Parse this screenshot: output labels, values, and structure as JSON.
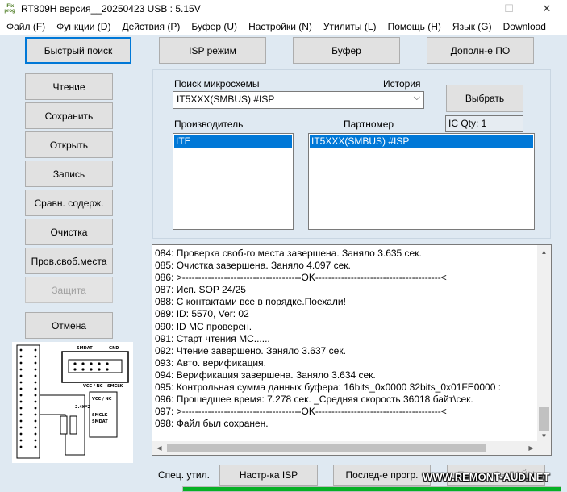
{
  "window": {
    "title": "RT809H версия__20250423  USB : 5.15V",
    "icon_text": [
      "iFix",
      "prog"
    ],
    "controls": {
      "minimize": "—",
      "maximize": "☐",
      "close": "✕"
    }
  },
  "menu": [
    "Файл (F)",
    "Функции (D)",
    "Действия (P)",
    "Буфер (U)",
    "Настройки (N)",
    "Утилиты (L)",
    "Помощь (H)",
    "Язык (G)",
    "Download"
  ],
  "top_buttons": {
    "quick_search": "Быстрый поиск",
    "isp_mode": "ISP режим",
    "buffer": "Буфер",
    "extra_software": "Дополн-е ПО"
  },
  "left_buttons": {
    "read": "Чтение",
    "save": "Сохранить",
    "open": "Открыть",
    "write": "Запись",
    "compare": "Сравн. содерж.",
    "erase": "Очистка",
    "blank_check": "Пров.своб.места",
    "protect": "Защита",
    "cancel": "Отмена"
  },
  "chip_search": {
    "label": "Поиск микросхемы",
    "history_label": "История",
    "value": "IT5XXX(SMBUS) #ISP",
    "select_button": "Выбрать",
    "ic_qty": "IC Qty: 1",
    "manufacturer_label": "Производитель",
    "part_label": "Партномер",
    "manufacturers": [
      "ITE"
    ],
    "parts": [
      "IT5XXX(SMBUS) #ISP"
    ]
  },
  "diagram": {
    "header_left": "SMDAT",
    "header_right": "GND",
    "bottom_left": "VCC / NC",
    "bottom_right": "SMCLK",
    "resistor": "2.4K*2",
    "side_vcc": "VCC / NC",
    "side_clk": "SMCLK",
    "side_dat": "SMDAT"
  },
  "log": [
    "084:  Проверка своб-го места завершена. Заняло 3.635 сек.",
    "085:  Очистка завершена. Заняло 4.097 сек.",
    "086:  >-------------------------------------OK---------------------------------------<",
    "087:  Исп. SOP 24/25",
    "088:  С контактами все в порядке.Поехали!",
    "089:  ID: 5570, Ver: 02",
    "090:  ID MC проверен.",
    "091:  Старт чтения MC......",
    "092:  Чтение завершено. Заняло 3.637 сек.",
    "093:  Авто. верификация.",
    "094:  Верификация завершена. Заняло 3.634 сек.",
    "095:  Контрольная сумма данных буфера: 16bits_0x0000  32bits_0x01FE0000 :",
    "096:  Прошедшее время: 7.278 сек. _Средняя скорость 36018 байт\\сек.",
    "097:  >-------------------------------------OK---------------------------------------<",
    "098:  Файл был сохранен."
  ],
  "bottom": {
    "special_label": "Спец. утил.",
    "isp_settings": "Настр-ка ISP",
    "sequential": "Послед-е прогр.",
    "online": "Провер ОНЛАЙН",
    "progress": 1.0
  },
  "watermark": "WWW.REMONT-AUD.NET"
}
